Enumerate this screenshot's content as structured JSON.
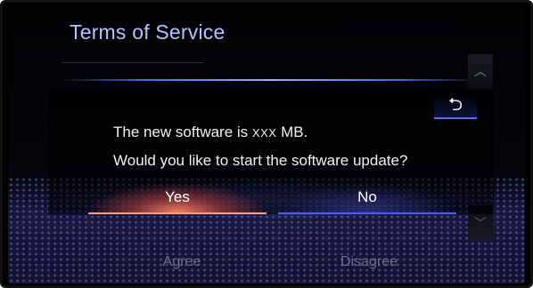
{
  "screen": {
    "title": "Terms of Service",
    "back_icon": "return-arrow-icon",
    "scroll_up_icon": "chevron-up-icon",
    "scroll_down_icon": "chevron-down-icon"
  },
  "dialog": {
    "line1_prefix": "The new software is ",
    "line1_size": "XXX",
    "line1_suffix": " MB.",
    "line2": "Would you like to start the software update?",
    "yes_label": "Yes",
    "no_label": "No"
  },
  "background_buttons": {
    "agree_label": "Agree",
    "disagree_label": "Disagree"
  },
  "colors": {
    "title": "#b9c0ff",
    "accent_blue": "#4a5bff",
    "yes_highlight": "#ff9b80"
  }
}
